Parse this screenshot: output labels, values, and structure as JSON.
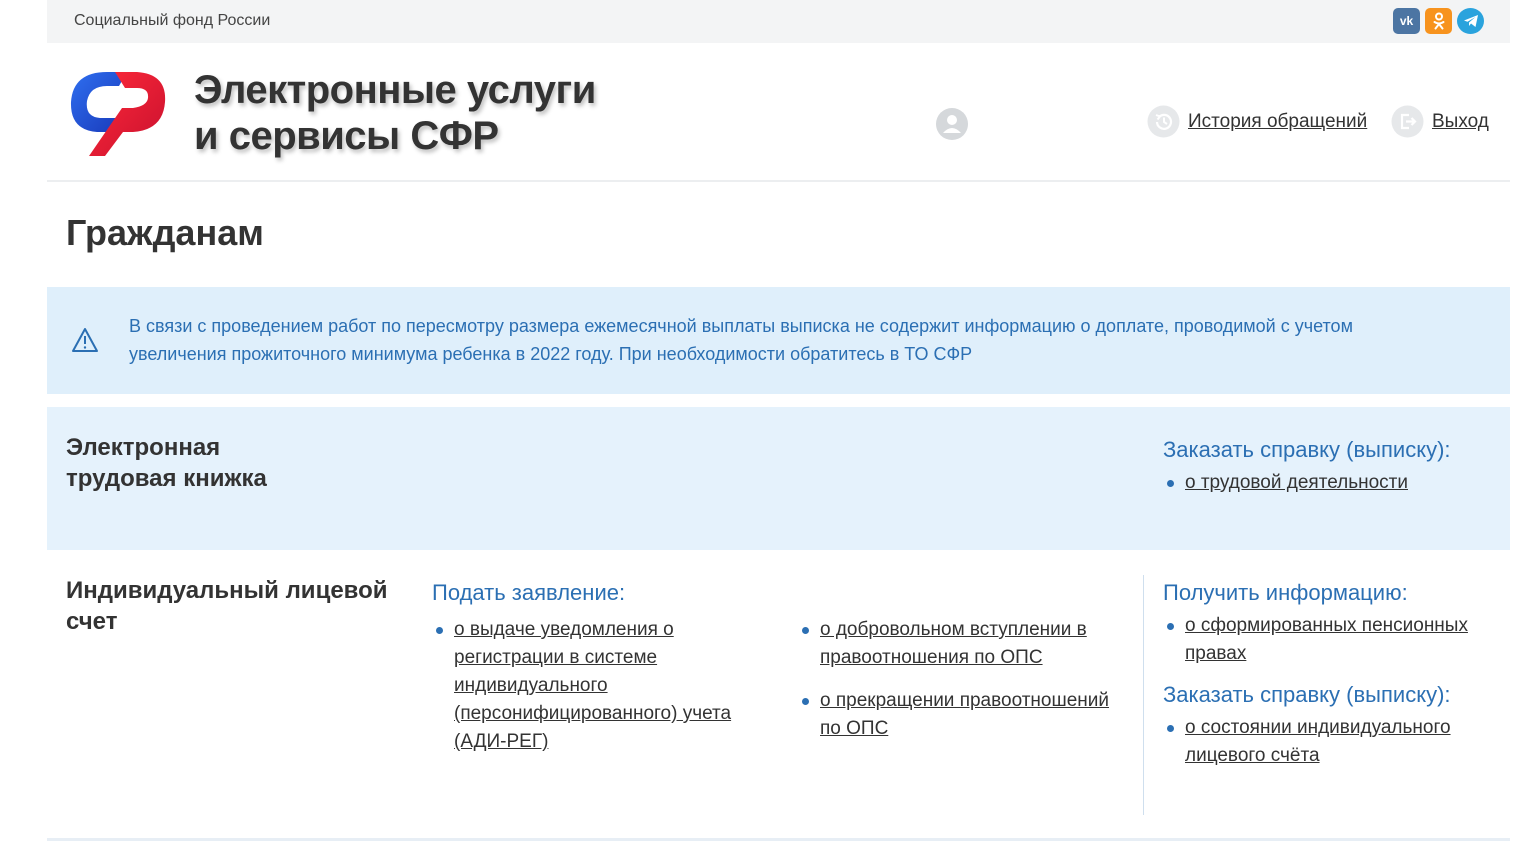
{
  "topbar": {
    "org_name": "Социальный фонд России",
    "social": [
      {
        "name": "vk-icon",
        "glyph": "vk"
      },
      {
        "name": "odnoklassniki-icon",
        "glyph": "ок"
      },
      {
        "name": "telegram-icon",
        "glyph": "➤"
      }
    ]
  },
  "header": {
    "title_line1": "Электронные услуги",
    "title_line2": "и сервисы СФР",
    "history_label": "История обращений",
    "logout_label": "Выход"
  },
  "page": {
    "title": "Гражданам"
  },
  "notice": {
    "text": "В связи с проведением работ по пересмотру размера ежемесячной выплаты выписка не содержит информацию о доплате, проводимой с учетом увеличения прожиточного минимума ребенка в 2022 году. При необходимости обратитесь в ТО СФР"
  },
  "ebook": {
    "title_line1": "Электронная",
    "title_line2": "трудовая книжка",
    "order_head": "Заказать справку (выписку):",
    "order_items": [
      "о трудовой деятельности"
    ]
  },
  "ils": {
    "title_line1": "Индивидуальный лицевой",
    "title_line2": "счет",
    "apply_head": "Подать заявление:",
    "apply_items_col1": [
      "о выдаче уведомления о регистрации в системе индивидуального (персонифицированного) учета (АДИ-РЕГ)"
    ],
    "apply_items_col2": [
      "о добровольном вступлении в правоотношения по ОПС",
      "о прекращении правоотношений по ОПС"
    ],
    "info_head": "Получить информацию:",
    "info_items": [
      "о сформированных пенсионных правах"
    ],
    "order_head": "Заказать справку (выписку):",
    "order_items": [
      "о состоянии индивидуального лицевого счёта"
    ]
  },
  "colors": {
    "accent_blue": "#2b6fb3",
    "notice_bg": "#dfeffb",
    "section_bg": "#e5f2fc",
    "logo_blue": "#1f4fd6",
    "logo_red": "#e3192d"
  }
}
